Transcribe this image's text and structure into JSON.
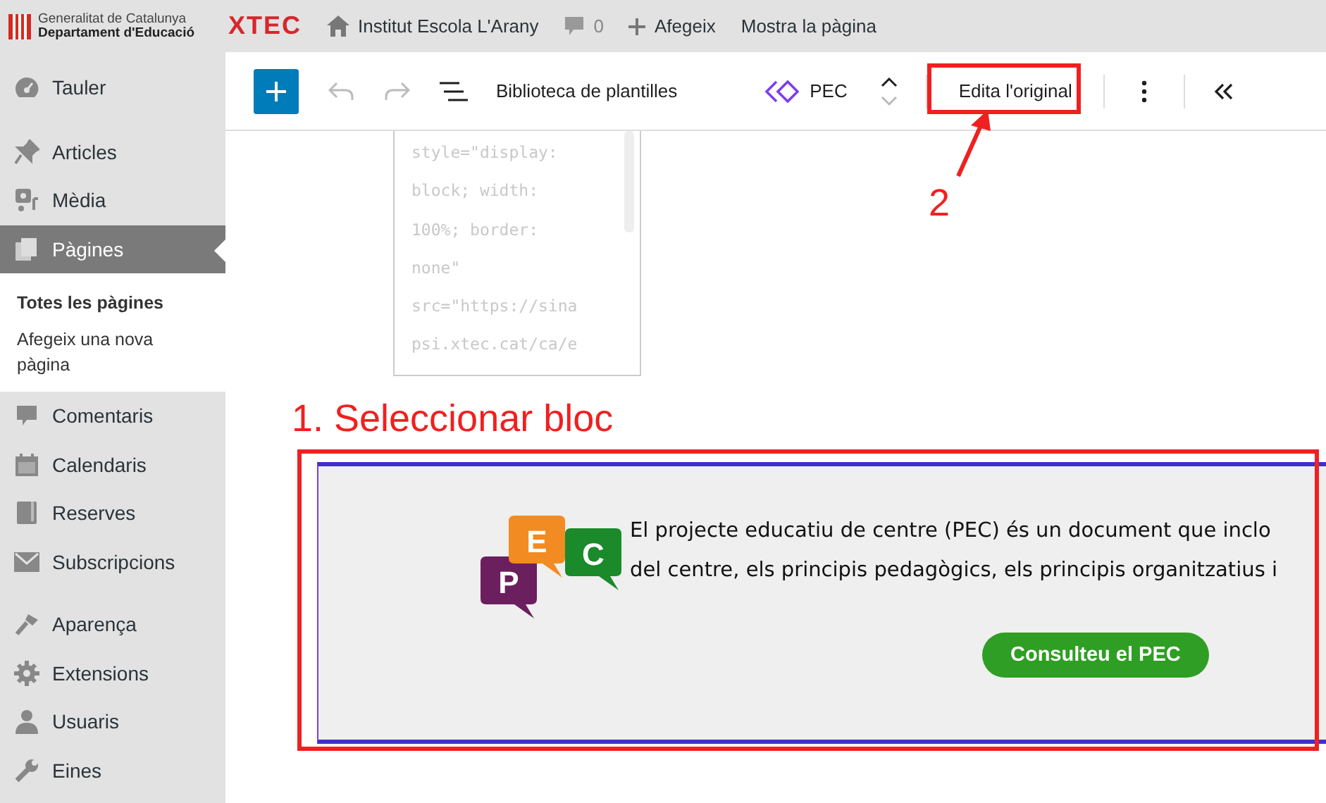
{
  "admin_bar": {
    "org_line_1": "Generalitat de Catalunya",
    "org_line_2": "Departament d'Educació",
    "brand": "XTEC",
    "site": "Institut Escola L'Arany",
    "comments": "0",
    "add": "Afegeix",
    "view": "Mostra la pàgina"
  },
  "sidebar": {
    "groups": [
      {
        "items": [
          {
            "label": "Tauler",
            "selected": false
          }
        ]
      },
      {
        "items": [
          {
            "label": "Articles",
            "selected": false
          },
          {
            "label": "Mèdia",
            "selected": false
          },
          {
            "label": "Pàgines",
            "selected": true,
            "submenu": [
              {
                "label": "Totes les pàgines",
                "selected": true
              },
              {
                "label": "Afegeix una nova pàgina",
                "selected": false
              }
            ]
          },
          {
            "label": "Comentaris",
            "selected": false
          },
          {
            "label": "Calendaris",
            "selected": false
          },
          {
            "label": "Reserves",
            "selected": false
          },
          {
            "label": "Subscripcions",
            "selected": false
          }
        ]
      },
      {
        "items": [
          {
            "label": "Aparença",
            "selected": false
          },
          {
            "label": "Extensions",
            "selected": false
          },
          {
            "label": "Usuaris",
            "selected": false
          },
          {
            "label": "Eines",
            "selected": false
          }
        ]
      }
    ]
  },
  "toolbar": {
    "templates": "Biblioteca de plantilles",
    "block_name": "PEC",
    "edit_button": "Edita l'original",
    "undo_disabled": true,
    "redo_disabled": true
  },
  "code_preview": {
    "lines": [
      "style=\"display:",
      "block; width:",
      "100%; border:",
      "none\"",
      "src=\"https://sina",
      "psi.xtec.cat/ca/e"
    ]
  },
  "block": {
    "logo_letters": [
      {
        "text": "P",
        "color": "#6b1f5e"
      },
      {
        "text": "E",
        "color": "#f28b21"
      },
      {
        "text": "C",
        "color": "#1a8a2a"
      }
    ],
    "text_lines": [
      "El projecte educatiu de centre (PEC) és un document que inclo",
      "del centre, els principis pedagògics, els principis organitzatius i"
    ],
    "button": "Consulteu el PEC"
  },
  "annotations": [
    {
      "text": "1. Seleccionar bloc"
    },
    {
      "text": "2"
    }
  ]
}
